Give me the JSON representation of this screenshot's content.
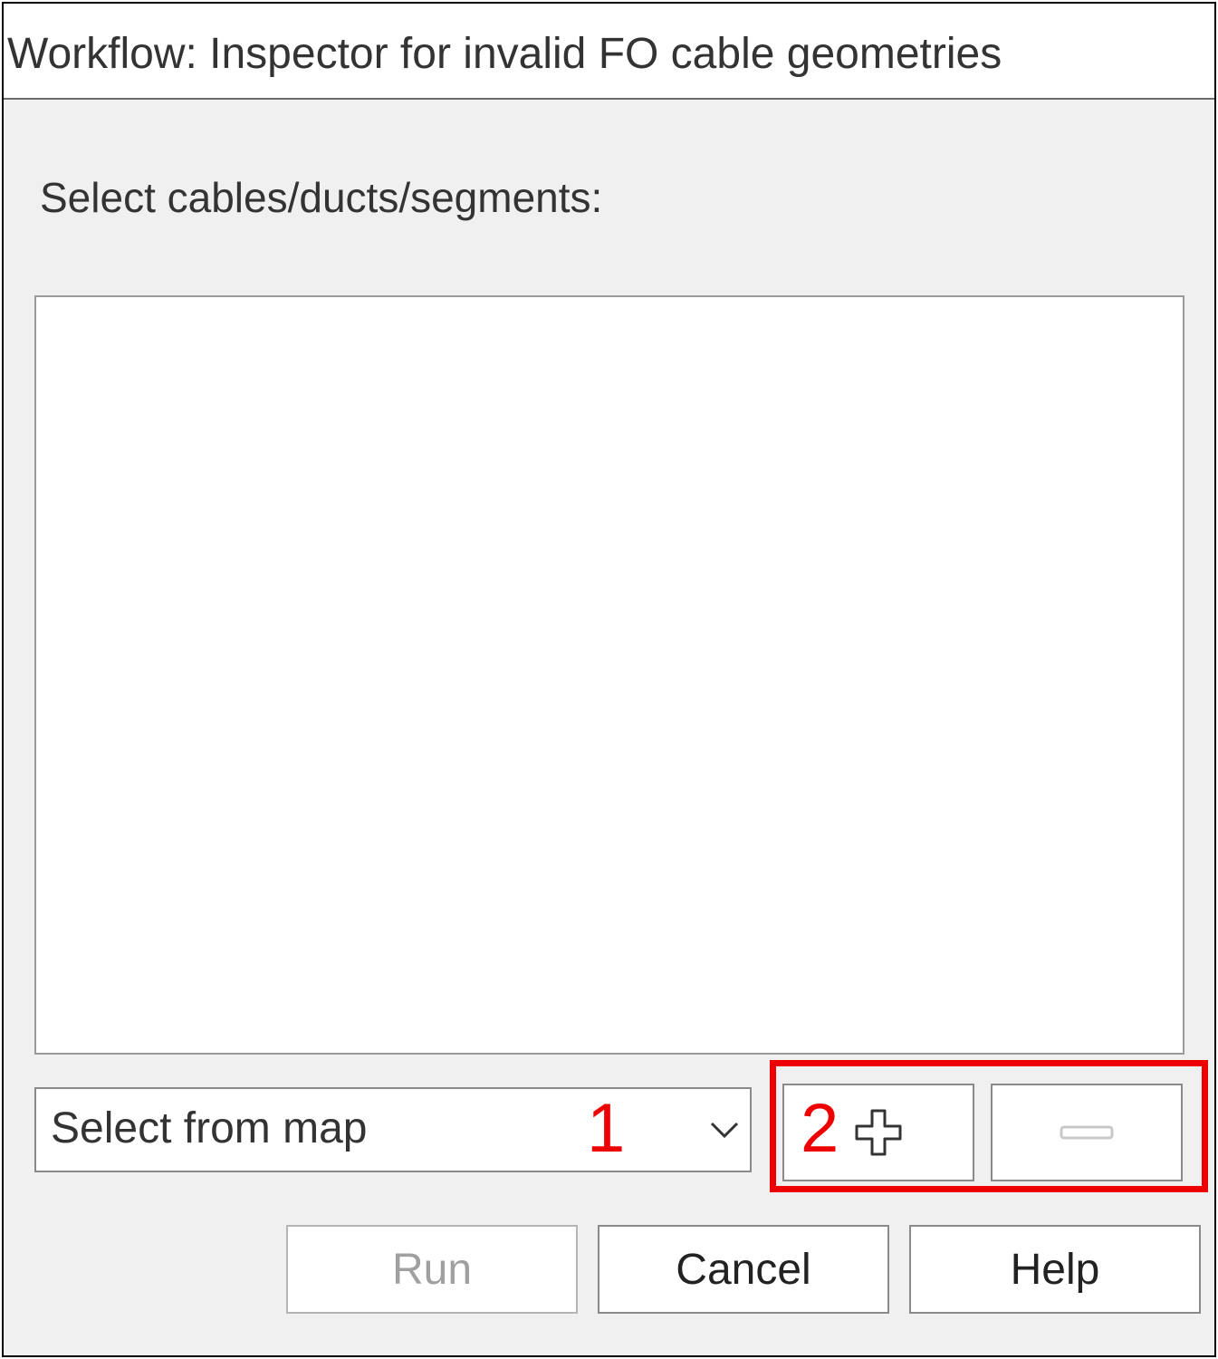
{
  "window": {
    "title": "Workflow: Inspector for invalid FO cable geometries"
  },
  "form": {
    "prompt_label": "Select cables/ducts/segments:",
    "selection_mode": {
      "selected_value": "Select from map"
    }
  },
  "annotations": {
    "marker_1": "1",
    "marker_2": "2",
    "color": "#ee0000"
  },
  "list_buttons": {
    "add_icon": "plus-icon",
    "remove_icon": "minus-icon"
  },
  "actions": {
    "run_label": "Run",
    "cancel_label": "Cancel",
    "help_label": "Help"
  }
}
